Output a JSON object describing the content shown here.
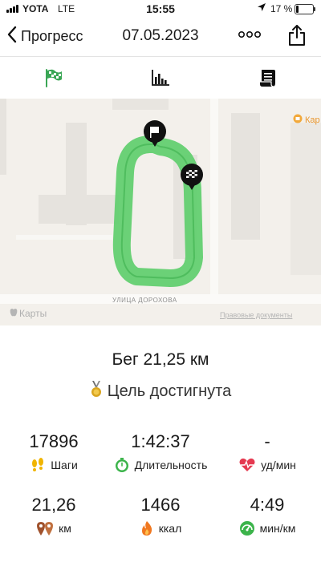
{
  "status_bar": {
    "carrier": "YOTA",
    "network": "LTE",
    "time": "15:55",
    "battery": "17 %",
    "battery_level": 0.17
  },
  "nav": {
    "back_label": "Прогресс",
    "title": "07.05.2023"
  },
  "tabs": [
    {
      "icon": "checkered-flag-icon",
      "active": true
    },
    {
      "icon": "bar-chart-icon",
      "active": false
    },
    {
      "icon": "notes-icon",
      "active": false
    }
  ],
  "map": {
    "street": "УЛИЦА ДОРОХОВА",
    "maps_label": "Карты",
    "legal": "Правовые документы",
    "poi": "Кар",
    "route_color": "#5ccd6a"
  },
  "summary": {
    "title": "Бег 21,25 км",
    "goal": "Цель достигнута"
  },
  "stats": [
    {
      "value": "17896",
      "label": "Шаги",
      "icon": "footprints-icon",
      "color": "#f0b400"
    },
    {
      "value": "1:42:37",
      "label": "Длительность",
      "icon": "stopwatch-icon",
      "color": "#3cb44b"
    },
    {
      "value": "-",
      "label": "уд/мин",
      "icon": "heart-rate-icon",
      "color": "#e53950"
    },
    {
      "value": "21,26",
      "label": "км",
      "icon": "location-pins-icon",
      "color": "#a0522d"
    },
    {
      "value": "1466",
      "label": "ккал",
      "icon": "flame-icon",
      "color": "#f07820"
    },
    {
      "value": "4:49",
      "label": "мин/км",
      "icon": "speedometer-icon",
      "color": "#3cb44b"
    }
  ]
}
